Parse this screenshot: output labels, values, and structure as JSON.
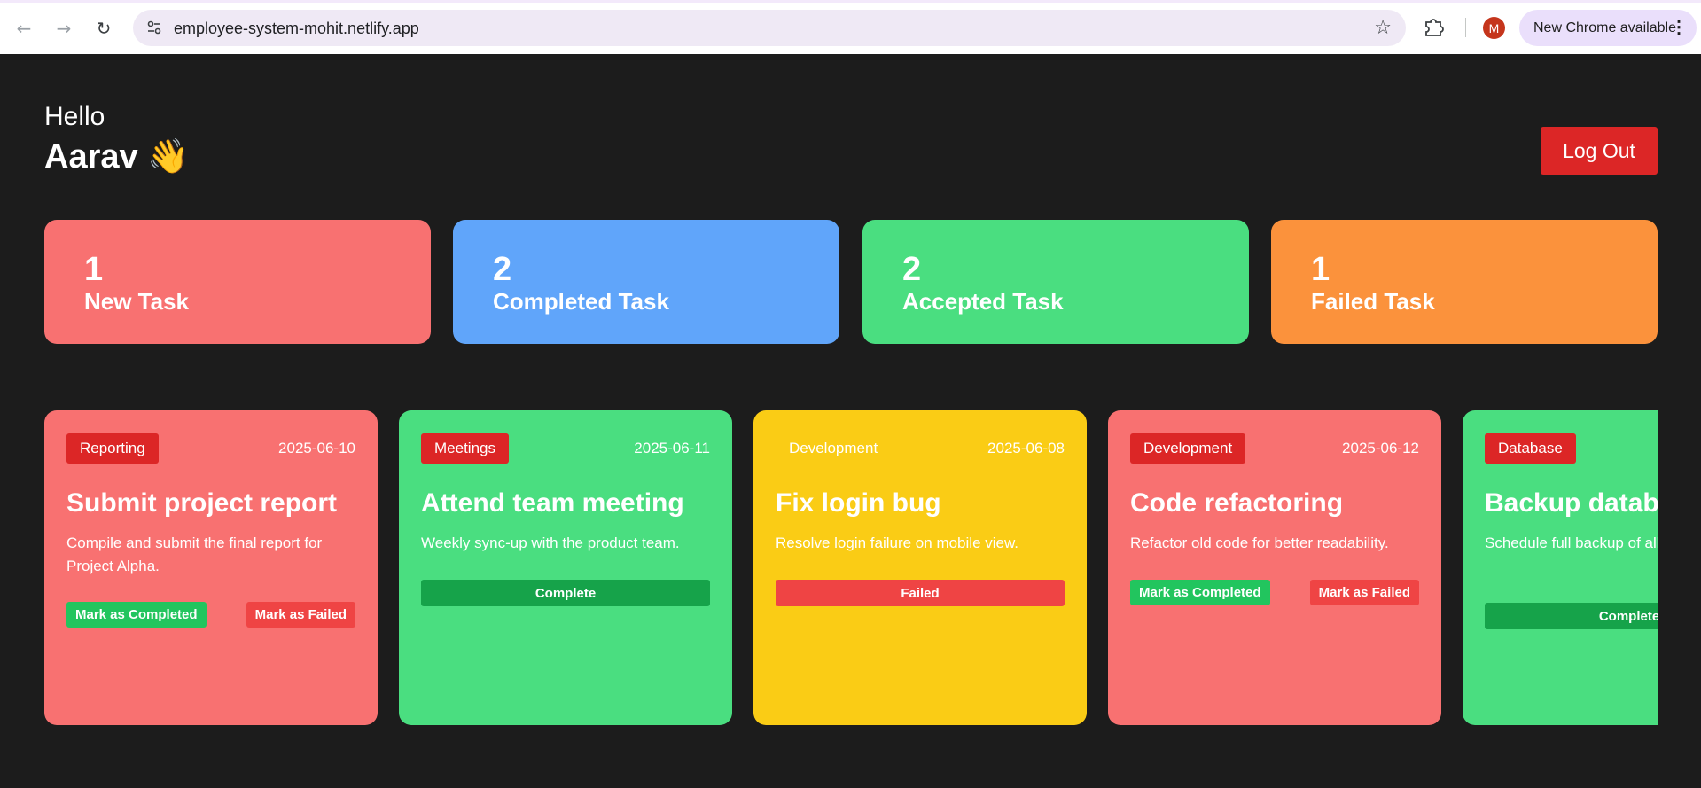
{
  "browser": {
    "url": "employee-system-mohit.netlify.app",
    "update_chip": "New Chrome available",
    "profile_initial": "M"
  },
  "header": {
    "greeting": "Hello",
    "name": "Aarav",
    "emoji": "👋",
    "logout_label": "Log Out"
  },
  "stats": [
    {
      "count": "1",
      "label": "New Task",
      "color": "#f87171"
    },
    {
      "count": "2",
      "label": "Completed Task",
      "color": "#60a5fa"
    },
    {
      "count": "2",
      "label": "Accepted Task",
      "color": "#4ade80"
    },
    {
      "count": "1",
      "label": "Failed Task",
      "color": "#fb923c"
    }
  ],
  "tasks": [
    {
      "category": "Reporting",
      "date": "2025-06-10",
      "title": "Submit project report",
      "description": "Compile and submit the final report for Project Alpha.",
      "complete_btn": "Mark as Completed",
      "fail_btn": "Mark as Failed",
      "color": "#f87171"
    },
    {
      "category": "Meetings",
      "date": "2025-06-11",
      "title": "Attend team meeting",
      "description": "Weekly sync-up with the product team.",
      "status_btn": "Complete",
      "color": "#4ade80"
    },
    {
      "category": "Development",
      "date": "2025-06-08",
      "title": "Fix login bug",
      "description": "Resolve login failure on mobile view.",
      "status_btn": "Failed",
      "color": "#facc15"
    },
    {
      "category": "Development",
      "date": "2025-06-12",
      "title": "Code refactoring",
      "description": "Refactor old code for better readability.",
      "complete_btn": "Mark as Completed",
      "fail_btn": "Mark as Failed",
      "color": "#f87171"
    },
    {
      "category": "Database",
      "date": "",
      "title": "Backup database",
      "description": "Schedule full backup of all databases.",
      "status_btn": "Complete",
      "color": "#4ade80"
    }
  ]
}
